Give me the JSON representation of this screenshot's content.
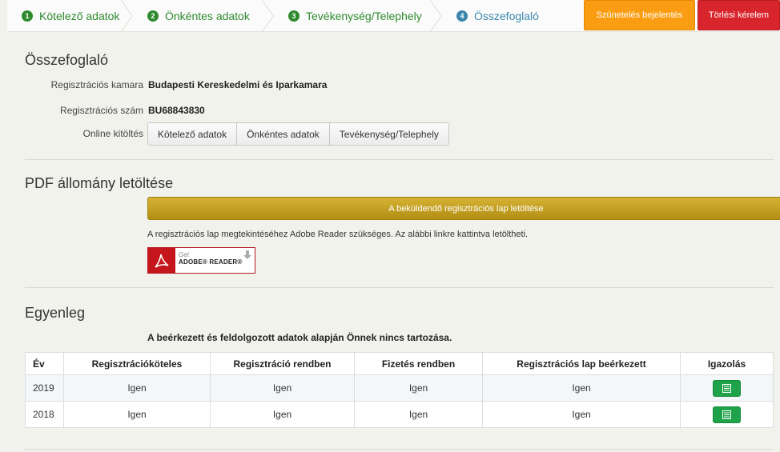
{
  "wizard": {
    "steps": [
      {
        "num": "1",
        "label": "Kötelező adatok"
      },
      {
        "num": "2",
        "label": "Önkéntes adatok"
      },
      {
        "num": "3",
        "label": "Tevékenység/Telephely"
      },
      {
        "num": "4",
        "label": "Összefoglaló"
      }
    ],
    "suspend_label": "Szünetelés bejelentés",
    "delete_label": "Törlési kérelem",
    "colors": {
      "done": "#2f8a2f",
      "active": "#3a87ad",
      "suspend": "#fa9d12",
      "delete": "#d8242b"
    }
  },
  "summary": {
    "title": "Összefoglaló",
    "chamber_label": "Regisztrációs kamara",
    "chamber_value": "Budapesti Kereskedelmi és Iparkamara",
    "regnum_label": "Regisztrációs szám",
    "regnum_value": "BU68843830",
    "online_label": "Online kitöltés",
    "online_buttons": [
      "Kötelező adatok",
      "Önkéntes adatok",
      "Tevékenység/Telephely"
    ]
  },
  "pdf": {
    "title": "PDF állomány letöltése",
    "download_label": "A beküldendő regisztrációs lap letöltése",
    "note": "A regisztrációs lap megtekintéséhez Adobe Reader szükséges. Az alábbi linkre kattintva letöltheti.",
    "adobe_get": "Get",
    "adobe_reader": "ADOBE® READER®"
  },
  "balance": {
    "title": "Egyenleg",
    "message": "A beérkezett és feldolgozott adatok alapján Önnek nincs tartozása.",
    "headers": [
      "Év",
      "Regisztrációköteles",
      "Regisztráció rendben",
      "Fizetés rendben",
      "Regisztrációs lap beérkezett",
      "Igazolás"
    ],
    "rows": [
      [
        "2019",
        "Igen",
        "Igen",
        "Igen",
        "Igen"
      ],
      [
        "2018",
        "Igen",
        "Igen",
        "Igen",
        "Igen"
      ]
    ]
  }
}
